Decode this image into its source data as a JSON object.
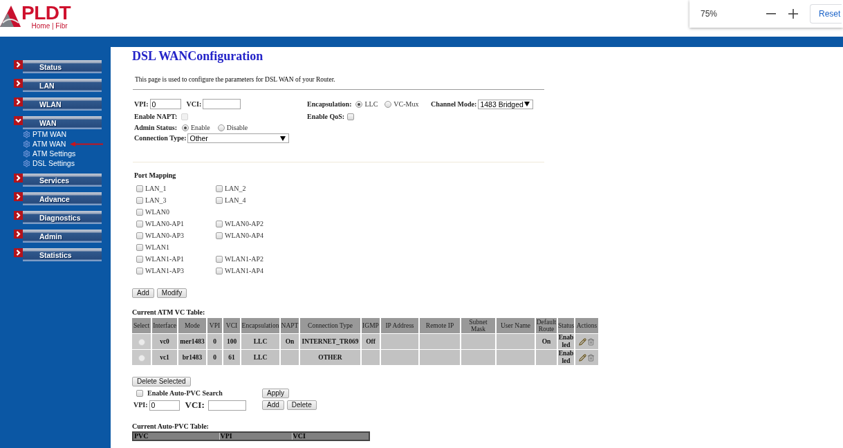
{
  "browser_zoom": {
    "percent": "75%",
    "reset": "Reset"
  },
  "logo": {
    "brand": "PLDT",
    "tagline": "Home | Fibr"
  },
  "sidebar": {
    "items": [
      {
        "label": "Status",
        "expanded": false
      },
      {
        "label": "LAN",
        "expanded": false
      },
      {
        "label": "WLAN",
        "expanded": false
      },
      {
        "label": "WAN",
        "expanded": true,
        "children": [
          {
            "label": "PTM WAN",
            "annotated": false
          },
          {
            "label": "ATM WAN",
            "annotated": true
          },
          {
            "label": "ATM Settings",
            "annotated": false
          },
          {
            "label": "DSL Settings",
            "annotated": false
          }
        ]
      },
      {
        "label": "Services",
        "expanded": false
      },
      {
        "label": "Advance",
        "expanded": false
      },
      {
        "label": "Diagnostics",
        "expanded": false
      },
      {
        "label": "Admin",
        "expanded": false
      },
      {
        "label": "Statistics",
        "expanded": false
      }
    ]
  },
  "page": {
    "title": "DSL WANConfiguration",
    "description": "This page is used to configure the parameters for DSL WAN of your Router."
  },
  "form": {
    "vpi": {
      "label": "VPI:",
      "value": "0"
    },
    "vci": {
      "label": "VCI:"
    },
    "encapsulation": {
      "label": "Encapsulation:",
      "options": [
        {
          "label": "LLC",
          "selected": true
        },
        {
          "label": "VC-Mux",
          "selected": false
        }
      ]
    },
    "channel_mode": {
      "label": "Channel Mode:",
      "value": "1483 Bridged"
    },
    "enable_napt": {
      "label": "Enable NAPT:",
      "checked": false,
      "disabled": true
    },
    "enable_qos": {
      "label": "Enable QoS:",
      "checked": false
    },
    "admin_status": {
      "label": "Admin Status:",
      "options": [
        {
          "label": "Enable",
          "selected": true
        },
        {
          "label": "Disable",
          "selected": false
        }
      ]
    },
    "connection_type": {
      "label": "Connection Type:",
      "value": "Other"
    }
  },
  "port_mapping": {
    "title": "Port Mapping",
    "rows": [
      [
        {
          "label": "LAN_1",
          "checked": false
        },
        {
          "label": "LAN_2",
          "checked": false
        }
      ],
      [
        {
          "label": "LAN_3",
          "checked": false
        },
        {
          "label": "LAN_4",
          "checked": false
        }
      ],
      [
        {
          "label": "WLAN0",
          "checked": false
        }
      ],
      [
        {
          "label": "WLAN0-AP1",
          "checked": false
        },
        {
          "label": "WLAN0-AP2",
          "checked": false
        }
      ],
      [
        {
          "label": "WLAN0-AP3",
          "checked": false
        },
        {
          "label": "WLAN0-AP4",
          "checked": false
        }
      ],
      [
        {
          "label": "WLAN1",
          "checked": false
        }
      ],
      [
        {
          "label": "WLAN1-AP1",
          "checked": false
        },
        {
          "label": "WLAN1-AP2",
          "checked": false
        }
      ],
      [
        {
          "label": "WLAN1-AP3",
          "checked": false
        },
        {
          "label": "WLAN1-AP4",
          "checked": false
        }
      ]
    ]
  },
  "form_buttons": [
    "Add",
    "Modify"
  ],
  "vc_table": {
    "title": "Current ATM VC Table:",
    "select_column": "Select",
    "columns": [
      "Interface",
      "Mode",
      "VPI",
      "VCI",
      "Encapsulation",
      "NAPT",
      "Connection Type",
      "IGMP",
      "IP Address",
      "Remote IP",
      "Subnet Mask",
      "User Name",
      "Default Route",
      "Status"
    ],
    "actions_column": "Actions",
    "rows": [
      {
        "selected": false,
        "cells": [
          "vc0",
          "mer1483",
          "0",
          "100",
          "LLC",
          "On",
          "INTERNET_TR069",
          "Off",
          null,
          null,
          null,
          null,
          "On",
          "Enabled"
        ]
      },
      {
        "selected": false,
        "cells": [
          "vc1",
          "br1483",
          "0",
          "61",
          "LLC",
          null,
          "OTHER",
          null,
          null,
          null,
          null,
          null,
          null,
          "Enabled"
        ]
      }
    ]
  },
  "delete_selected": "Delete Selected",
  "auto_pvc": {
    "search": {
      "label": "Enable Auto-PVC Search",
      "checked": false
    },
    "apply": "Apply",
    "vpi": {
      "label": "VPI:",
      "value": "0"
    },
    "vci": {
      "label": "VCI:"
    },
    "buttons": [
      "Add",
      "Delete"
    ]
  },
  "auto_pvc_table": {
    "title": "Current Auto-PVC Table:",
    "columns": [
      "PVC",
      "VPI",
      "VCI"
    ]
  }
}
